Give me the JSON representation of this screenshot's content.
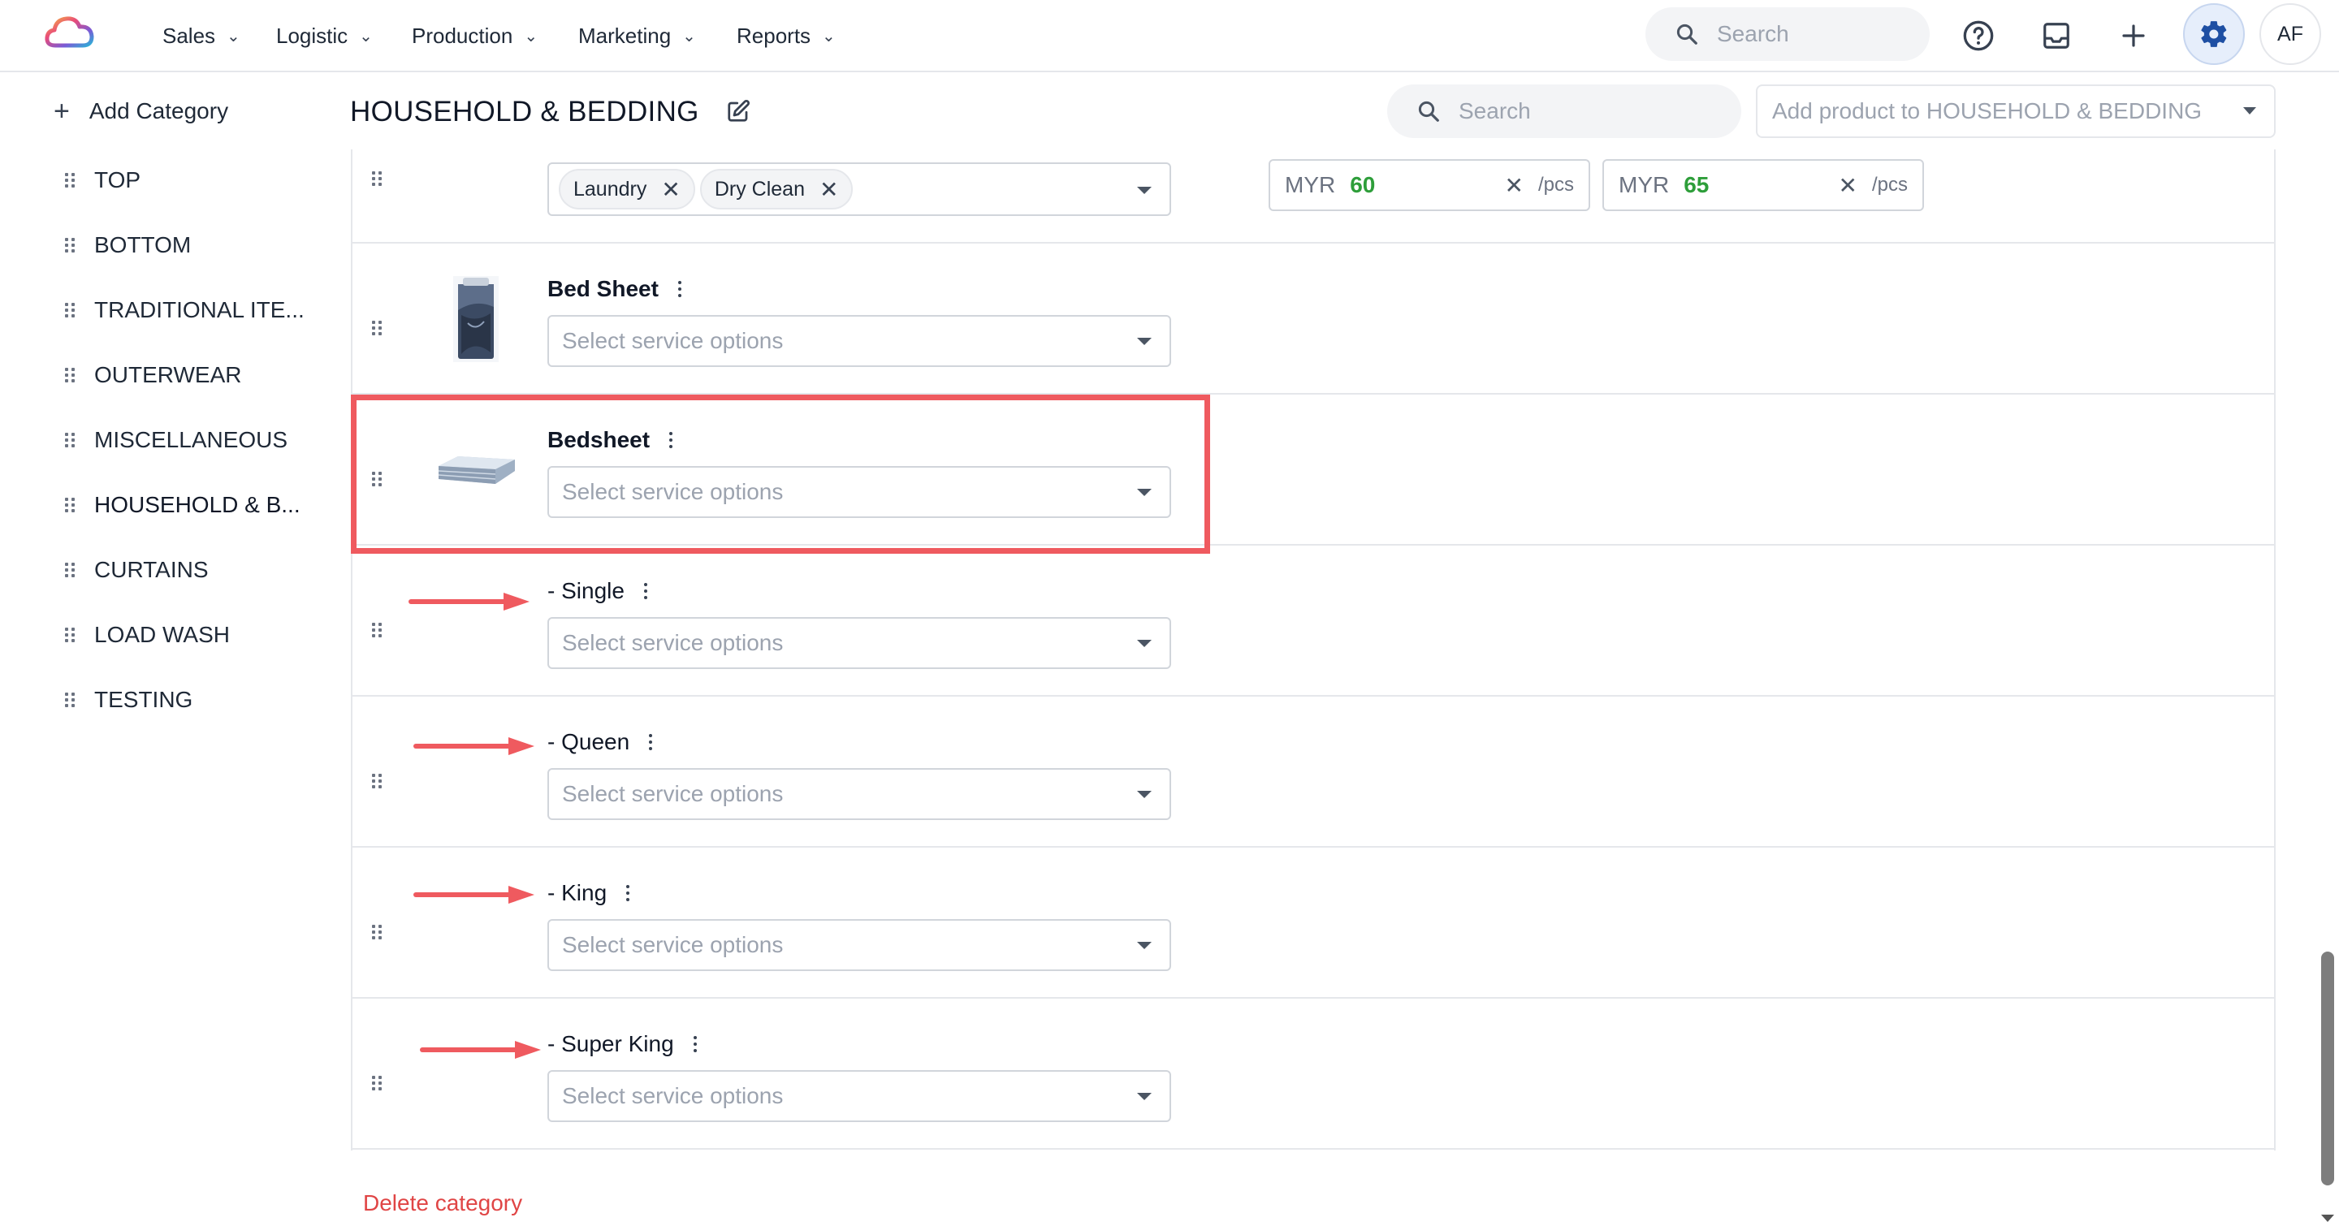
{
  "nav": {
    "items": [
      "Sales",
      "Logistic",
      "Production",
      "Marketing",
      "Reports"
    ],
    "search_placeholder": "Search",
    "avatar_initials": "AF"
  },
  "sidebar": {
    "add_category": "Add Category",
    "categories": [
      "TOP",
      "BOTTOM",
      "TRADITIONAL ITE...",
      "OUTERWEAR",
      "MISCELLANEOUS",
      "HOUSEHOLD & B...",
      "CURTAINS",
      "LOAD WASH",
      "TESTING"
    ],
    "active_index": 5
  },
  "header": {
    "title": "HOUSEHOLD & BEDDING",
    "search_placeholder": "Search",
    "add_product_placeholder": "Add product to HOUSEHOLD & BEDDING"
  },
  "products": [
    {
      "name": "",
      "chips": [
        "Laundry",
        "Dry Clean"
      ],
      "prices": [
        {
          "currency": "MYR",
          "value": "60",
          "unit": "/pcs"
        },
        {
          "currency": "MYR",
          "value": "65",
          "unit": "/pcs"
        }
      ]
    },
    {
      "name": "Bed Sheet",
      "select_placeholder": "Select service options",
      "image": "bed-sheet-photo"
    },
    {
      "name": "Bedsheet",
      "select_placeholder": "Select service options",
      "image": "folded-bedsheet-photo",
      "highlighted": true
    },
    {
      "name": "- Single",
      "select_placeholder": "Select service options"
    },
    {
      "name": "- Queen",
      "select_placeholder": "Select service options"
    },
    {
      "name": "- King",
      "select_placeholder": "Select service options"
    },
    {
      "name": "- Super King",
      "select_placeholder": "Select service options"
    }
  ],
  "footer": {
    "delete_category": "Delete category"
  },
  "colors": {
    "accent": "#ef5a5f",
    "price_value": "#2e9e3a",
    "delete": "#e04545",
    "gear_bg": "#e6eefb"
  },
  "icons": [
    "app-logo-icon",
    "search-icon",
    "help-icon",
    "inbox-icon",
    "plus-icon",
    "gear-icon",
    "edit-icon",
    "drag-handle-icon",
    "kebab-menu-icon",
    "chevron-down-icon",
    "close-icon",
    "arrow-right-icon"
  ]
}
